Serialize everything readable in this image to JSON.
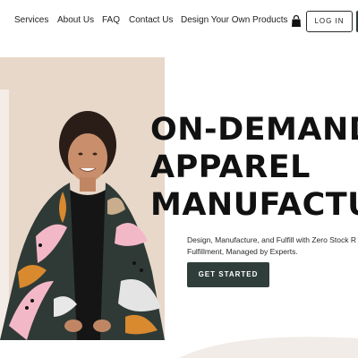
{
  "nav": {
    "links": [
      "Services",
      "About Us",
      "FAQ",
      "Contact Us",
      "Design Your Own Products"
    ],
    "login_label": "LOG IN",
    "cart_icon": "shopping-bag-icon"
  },
  "hero": {
    "headline_lines": [
      "ON-DEMAND",
      "APPAREL",
      "MANUFACTU"
    ],
    "subcopy_lines": [
      "Design, Manufacture, and Fulfill with Zero Stock R",
      "Fulfillment, Managed by Experts."
    ],
    "cta_label": "GET STARTED",
    "image": "woman-wrapped-in-printed-blanket"
  },
  "colors": {
    "accent": "#2f3e3a",
    "hero_background": "#e9d9cc",
    "text": "#1f1f1f"
  }
}
